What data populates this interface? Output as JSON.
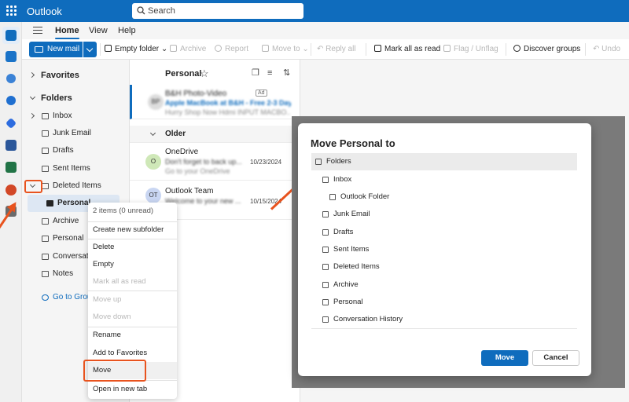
{
  "app": {
    "title": "Outlook",
    "search_placeholder": "Search"
  },
  "colors": {
    "brand": "#0f6cbd",
    "annotation": "#e8531e"
  },
  "tabs": [
    "Home",
    "View",
    "Help"
  ],
  "ribbon": {
    "new_mail": "New mail",
    "empty_folder": "Empty folder",
    "archive": "Archive",
    "report": "Report",
    "move_to": "Move to",
    "reply_all": "Reply all",
    "mark_all_read": "Mark all as read",
    "flag_unflag": "Flag / Unflag",
    "discover_groups": "Discover groups",
    "undo": "Undo"
  },
  "folders": {
    "favorites": "Favorites",
    "folders_header": "Folders",
    "inbox": "Inbox",
    "junk": "Junk Email",
    "drafts": "Drafts",
    "sent": "Sent Items",
    "deleted": "Deleted Items",
    "personal_sub": "Personal",
    "archive": "Archive",
    "personal": "Personal",
    "conversation": "Conversation History",
    "notes": "Notes",
    "go_to_groups": "Go to Groups"
  },
  "message_list": {
    "title": "Personal",
    "older_label": "Older",
    "messages": [
      {
        "avatar": "BP",
        "sender": "B&H Photo-Video",
        "subject": "Apple MacBook at B&H - Free 2-3 Day I",
        "preview": "Hurry Shop Now Hdmi INPUT MACBO...",
        "badge": "Ad"
      },
      {
        "avatar": "O",
        "sender": "OneDrive",
        "subject": "Don't forget to back up...",
        "preview": "Go to your OneDrive",
        "date": "10/23/2024"
      },
      {
        "avatar": "OT",
        "sender": "Outlook Team",
        "subject": "Welcome to your new ...",
        "preview": "",
        "date": "10/15/2024"
      }
    ]
  },
  "context_menu": {
    "info": "2 items (0 unread)",
    "create_subfolder": "Create new subfolder",
    "delete": "Delete",
    "empty": "Empty",
    "mark_all_read": "Mark all as read",
    "move_up": "Move up",
    "move_down": "Move down",
    "rename": "Rename",
    "add_favorites": "Add to Favorites",
    "move": "Move",
    "open_new_tab": "Open in new tab"
  },
  "dialog": {
    "title": "Move Personal to",
    "tree": {
      "folders": "Folders",
      "inbox": "Inbox",
      "outlook_folder": "Outlook Folder",
      "junk": "Junk Email",
      "drafts": "Drafts",
      "sent": "Sent Items",
      "deleted": "Deleted Items",
      "archive": "Archive",
      "personal": "Personal",
      "conversation": "Conversation History"
    },
    "move_button": "Move",
    "cancel_button": "Cancel"
  }
}
